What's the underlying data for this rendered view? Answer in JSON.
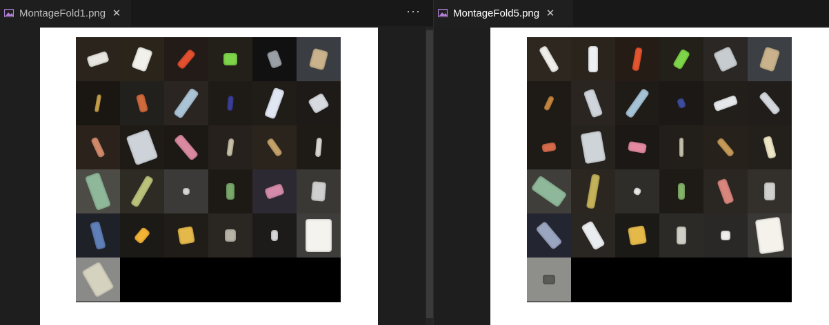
{
  "left": {
    "tab_title": "MontageFold1.png",
    "close_glyph": "✕",
    "more_glyph": "···",
    "tiles": [
      {
        "bg": "#2a241c",
        "obj": "#e8e6e0",
        "w": 30,
        "h": 16,
        "r": -18
      },
      {
        "bg": "#2b241b",
        "obj": "#f2f0ea",
        "w": 22,
        "h": 32,
        "r": 20
      },
      {
        "bg": "#231b17",
        "obj": "#e3502f",
        "w": 12,
        "h": 30,
        "r": 40
      },
      {
        "bg": "#232019",
        "obj": "#7fd54a",
        "w": 20,
        "h": 18,
        "r": 0
      },
      {
        "bg": "#111111",
        "obj": "#9aa0a6",
        "w": 16,
        "h": 24,
        "r": -20
      },
      {
        "bg": "#3a3d41",
        "obj": "#c9b28c",
        "w": 22,
        "h": 28,
        "r": 15
      },
      {
        "bg": "#1a1612",
        "obj": "#c9a24a",
        "w": 6,
        "h": 26,
        "r": 10
      },
      {
        "bg": "#22201c",
        "obj": "#d06a3c",
        "w": 12,
        "h": 26,
        "r": -15
      },
      {
        "bg": "#2a2520",
        "obj": "#aac4d6",
        "w": 14,
        "h": 46,
        "r": 35
      },
      {
        "bg": "#1e1a16",
        "obj": "#3b3f98",
        "w": 8,
        "h": 22,
        "r": 5
      },
      {
        "bg": "#201c18",
        "obj": "#e0e6f2",
        "w": 16,
        "h": 44,
        "r": 20
      },
      {
        "bg": "#1d1a18",
        "obj": "#d7dbe0",
        "w": 24,
        "h": 22,
        "r": -30
      },
      {
        "bg": "#2a221b",
        "obj": "#d28a6a",
        "w": 10,
        "h": 30,
        "r": -25
      },
      {
        "bg": "#1e1a16",
        "obj": "#cdd3d8",
        "w": 34,
        "h": 44,
        "r": -20
      },
      {
        "bg": "#1c1814",
        "obj": "#d98aa0",
        "w": 14,
        "h": 40,
        "r": -40
      },
      {
        "bg": "#26211c",
        "obj": "#c8c1a7",
        "w": 8,
        "h": 26,
        "r": 8
      },
      {
        "bg": "#2b241d",
        "obj": "#c5a26a",
        "w": 10,
        "h": 28,
        "r": -35
      },
      {
        "bg": "#1e1b17",
        "obj": "#d8d8d0",
        "w": 8,
        "h": 28,
        "r": 5
      },
      {
        "bg": "#4d4b45",
        "obj": "#8fb89a",
        "w": 22,
        "h": 52,
        "r": -20
      },
      {
        "bg": "#2e2a24",
        "obj": "#b9c27a",
        "w": 12,
        "h": 48,
        "r": 30
      },
      {
        "bg": "#3b3a38",
        "obj": "#d9d9d9",
        "w": 10,
        "h": 10,
        "r": 0
      },
      {
        "bg": "#1d1a16",
        "obj": "#79a86a",
        "w": 12,
        "h": 24,
        "r": 0
      },
      {
        "bg": "#2c2932",
        "obj": "#d48aa8",
        "w": 26,
        "h": 16,
        "r": -20
      },
      {
        "bg": "#3a3834",
        "obj": "#cfcfd0",
        "w": 20,
        "h": 28,
        "r": 5
      },
      {
        "bg": "#1f2128",
        "obj": "#5e7fb8",
        "w": 14,
        "h": 40,
        "r": -15
      },
      {
        "bg": "#1c1a17",
        "obj": "#f2b336",
        "w": 14,
        "h": 22,
        "r": 40
      },
      {
        "bg": "#201d19",
        "obj": "#e4b94a",
        "w": 22,
        "h": 24,
        "r": -10
      },
      {
        "bg": "#2a2622",
        "obj": "#b7b3a7",
        "w": 16,
        "h": 18,
        "r": 0
      },
      {
        "bg": "#1c1b1a",
        "obj": "#d6d7d8",
        "w": 10,
        "h": 16,
        "r": 0
      },
      {
        "bg": "#3e3d3b",
        "obj": "#f5f3ee",
        "w": 38,
        "h": 48,
        "r": 0
      },
      {
        "bg": "#8a8a88",
        "obj": "#d6d2c0",
        "w": 30,
        "h": 44,
        "r": -30
      },
      {
        "bg": "#000000",
        "obj": "#000000",
        "w": 0,
        "h": 0,
        "r": 0
      },
      {
        "bg": "#000000",
        "obj": "#000000",
        "w": 0,
        "h": 0,
        "r": 0
      },
      {
        "bg": "#000000",
        "obj": "#000000",
        "w": 0,
        "h": 0,
        "r": 0
      },
      {
        "bg": "#000000",
        "obj": "#000000",
        "w": 0,
        "h": 0,
        "r": 0
      },
      {
        "bg": "#000000",
        "obj": "#000000",
        "w": 0,
        "h": 0,
        "r": 0
      }
    ]
  },
  "right": {
    "tab_title": "MontageFold5.png",
    "close_glyph": "✕",
    "tiles": [
      {
        "bg": "#2d271f",
        "obj": "#f0eee8",
        "w": 12,
        "h": 40,
        "r": -30
      },
      {
        "bg": "#2a241c",
        "obj": "#eef0f4",
        "w": 14,
        "h": 38,
        "r": 0
      },
      {
        "bg": "#251c16",
        "obj": "#e4562f",
        "w": 10,
        "h": 34,
        "r": 10
      },
      {
        "bg": "#222019",
        "obj": "#7fd54a",
        "w": 14,
        "h": 28,
        "r": 30
      },
      {
        "bg": "#2a2724",
        "obj": "#c7ccd0",
        "w": 26,
        "h": 30,
        "r": -25
      },
      {
        "bg": "#3c3f43",
        "obj": "#c9b28c",
        "w": 22,
        "h": 32,
        "r": 18
      },
      {
        "bg": "#1e1a15",
        "obj": "#c7863e",
        "w": 8,
        "h": 22,
        "r": 25
      },
      {
        "bg": "#2a2521",
        "obj": "#cfd5da",
        "w": 16,
        "h": 40,
        "r": -20
      },
      {
        "bg": "#1f1b17",
        "obj": "#a6c3d6",
        "w": 12,
        "h": 46,
        "r": 35
      },
      {
        "bg": "#1c1815",
        "obj": "#3e4da0",
        "w": 10,
        "h": 14,
        "r": -20
      },
      {
        "bg": "#221e1a",
        "obj": "#e5e7ea",
        "w": 14,
        "h": 34,
        "r": 70
      },
      {
        "bg": "#201d1a",
        "obj": "#d4d8dd",
        "w": 12,
        "h": 36,
        "r": -40
      },
      {
        "bg": "#1e1a16",
        "obj": "#d56b4a",
        "w": 20,
        "h": 12,
        "r": -10
      },
      {
        "bg": "#26221d",
        "obj": "#cfd4d9",
        "w": 30,
        "h": 44,
        "r": -10
      },
      {
        "bg": "#1b1815",
        "obj": "#e38aa0",
        "w": 26,
        "h": 14,
        "r": 10
      },
      {
        "bg": "#221e19",
        "obj": "#c8c4ad",
        "w": 6,
        "h": 28,
        "r": 0
      },
      {
        "bg": "#26211b",
        "obj": "#c59b58",
        "w": 10,
        "h": 30,
        "r": -40
      },
      {
        "bg": "#231f1a",
        "obj": "#ece6c6",
        "w": 12,
        "h": 32,
        "r": -15
      },
      {
        "bg": "#403e3a",
        "obj": "#8fb89a",
        "w": 24,
        "h": 48,
        "r": -55
      },
      {
        "bg": "#2b2620",
        "obj": "#c3b25a",
        "w": 12,
        "h": 50,
        "r": 10
      },
      {
        "bg": "#2f2d2a",
        "obj": "#e9e9e9",
        "w": 10,
        "h": 10,
        "r": 25
      },
      {
        "bg": "#1e1b17",
        "obj": "#84b26a",
        "w": 10,
        "h": 24,
        "r": 0
      },
      {
        "bg": "#2a2622",
        "obj": "#d9867e",
        "w": 14,
        "h": 36,
        "r": -20
      },
      {
        "bg": "#33302b",
        "obj": "#d0d0ce",
        "w": 16,
        "h": 26,
        "r": 0
      },
      {
        "bg": "#232631",
        "obj": "#9aa6c0",
        "w": 18,
        "h": 40,
        "r": -40
      },
      {
        "bg": "#2a2622",
        "obj": "#eaedef",
        "w": 18,
        "h": 40,
        "r": -30
      },
      {
        "bg": "#1c1a16",
        "obj": "#e4b94a",
        "w": 24,
        "h": 26,
        "r": -10
      },
      {
        "bg": "#2c2a27",
        "obj": "#d1cec6",
        "w": 14,
        "h": 26,
        "r": 0
      },
      {
        "bg": "#2a2826",
        "obj": "#f0eeea",
        "w": 14,
        "h": 14,
        "r": 0
      },
      {
        "bg": "#3a3835",
        "obj": "#f5f2ec",
        "w": 36,
        "h": 50,
        "r": -8
      },
      {
        "bg": "#8e8e8a",
        "obj": "#5b5a55",
        "w": 18,
        "h": 14,
        "r": 0
      },
      {
        "bg": "#000000",
        "obj": "#000000",
        "w": 0,
        "h": 0,
        "r": 0
      },
      {
        "bg": "#000000",
        "obj": "#000000",
        "w": 0,
        "h": 0,
        "r": 0
      },
      {
        "bg": "#000000",
        "obj": "#000000",
        "w": 0,
        "h": 0,
        "r": 0
      },
      {
        "bg": "#000000",
        "obj": "#000000",
        "w": 0,
        "h": 0,
        "r": 0
      },
      {
        "bg": "#000000",
        "obj": "#000000",
        "w": 0,
        "h": 0,
        "r": 0
      }
    ]
  },
  "colors": {
    "editor_bg": "#1e1e1e",
    "tabbar_bg": "#181818",
    "image_icon": "#b180d7",
    "canvas": "#ffffff"
  }
}
